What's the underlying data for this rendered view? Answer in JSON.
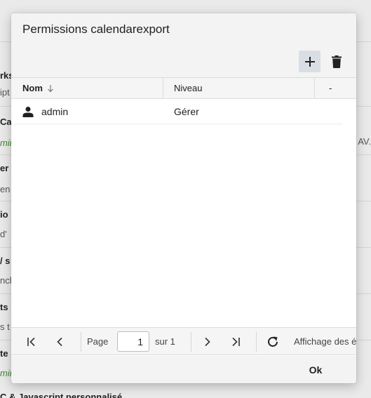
{
  "background": {
    "lines": [
      "rks",
      "ipt",
      "Ca",
      "mir",
      "er",
      "en",
      "io",
      "d'",
      "/ s",
      "ncl",
      "ts",
      "s t",
      "te",
      "mir",
      "C & Javascript personnalisé"
    ],
    "right_text": "AV."
  },
  "dialog": {
    "title": "Permissions calendarexport",
    "toolbar": {
      "add_icon": "plus-icon",
      "delete_icon": "trash-icon"
    },
    "columns": [
      {
        "label": "Nom",
        "sorted": "desc"
      },
      {
        "label": "Niveau"
      },
      {
        "label": "-"
      }
    ],
    "rows": [
      {
        "name": "admin",
        "level": "Gérer",
        "icon": "user-icon"
      }
    ],
    "pager": {
      "page_label": "Page",
      "page_value": "1",
      "of_label": "sur 1",
      "display_text": "Affichage des é"
    },
    "footer": {
      "ok_label": "Ok"
    }
  }
}
